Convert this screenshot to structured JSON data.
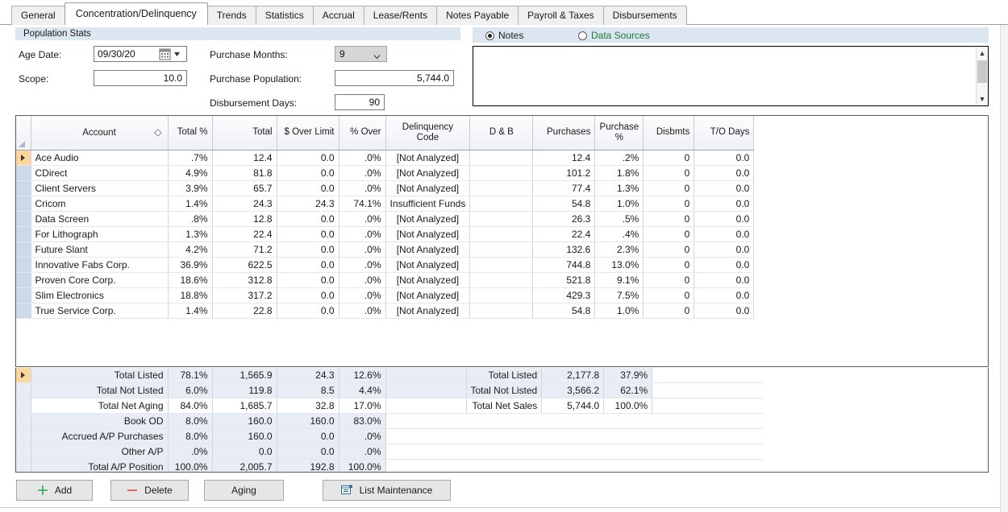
{
  "tabs": [
    {
      "label": "General",
      "active": false
    },
    {
      "label": "Concentration/Delinquency",
      "active": true
    },
    {
      "label": "Trends",
      "active": false
    },
    {
      "label": "Statistics",
      "active": false
    },
    {
      "label": "Accrual",
      "active": false
    },
    {
      "label": "Lease/Rents",
      "active": false
    },
    {
      "label": "Notes Payable",
      "active": false
    },
    {
      "label": "Payroll & Taxes",
      "active": false
    },
    {
      "label": "Disbursements",
      "active": false
    }
  ],
  "population_stats": {
    "group_title": "Population Stats",
    "age_date_label": "Age Date:",
    "age_date_value": "09/30/20",
    "scope_label": "Scope:",
    "scope_value": "10.0",
    "purchase_months_label": "Purchase Months:",
    "purchase_months_value": "9",
    "purchase_population_label": "Purchase Population:",
    "purchase_population_value": "5,744.0",
    "disbursement_days_label": "Disbursement Days:",
    "disbursement_days_value": "90"
  },
  "notes_panel": {
    "notes_label": "Notes",
    "data_sources_label": "Data Sources",
    "notes_text": "",
    "selected": "Notes"
  },
  "grid": {
    "columns": [
      "Account",
      "Total %",
      "Total",
      "$ Over Limit",
      "% Over",
      "Delinquency Code",
      "D & B",
      "Purchases",
      "Purchase\n%",
      "Disbmts",
      "T/O Days"
    ],
    "rows": [
      {
        "account": "Ace Audio",
        "total_pct": ".7%",
        "total": "12.4",
        "over_limit": "0.0",
        "pct_over": ".0%",
        "delinquency": "[Not Analyzed]",
        "db": "",
        "purchases": "12.4",
        "purchase_pct": ".2%",
        "disbmts": "0",
        "to_days": "0.0",
        "current": true
      },
      {
        "account": "CDirect",
        "total_pct": "4.9%",
        "total": "81.8",
        "over_limit": "0.0",
        "pct_over": ".0%",
        "delinquency": "[Not Analyzed]",
        "db": "",
        "purchases": "101.2",
        "purchase_pct": "1.8%",
        "disbmts": "0",
        "to_days": "0.0",
        "current": false
      },
      {
        "account": "Client Servers",
        "total_pct": "3.9%",
        "total": "65.7",
        "over_limit": "0.0",
        "pct_over": ".0%",
        "delinquency": "[Not Analyzed]",
        "db": "",
        "purchases": "77.4",
        "purchase_pct": "1.3%",
        "disbmts": "0",
        "to_days": "0.0",
        "current": false
      },
      {
        "account": "Cricom",
        "total_pct": "1.4%",
        "total": "24.3",
        "over_limit": "24.3",
        "pct_over": "74.1%",
        "delinquency": "Insufficient Funds",
        "db": "",
        "purchases": "54.8",
        "purchase_pct": "1.0%",
        "disbmts": "0",
        "to_days": "0.0",
        "current": false
      },
      {
        "account": "Data Screen",
        "total_pct": ".8%",
        "total": "12.8",
        "over_limit": "0.0",
        "pct_over": ".0%",
        "delinquency": "[Not Analyzed]",
        "db": "",
        "purchases": "26.3",
        "purchase_pct": ".5%",
        "disbmts": "0",
        "to_days": "0.0",
        "current": false
      },
      {
        "account": "For Lithograph",
        "total_pct": "1.3%",
        "total": "22.4",
        "over_limit": "0.0",
        "pct_over": ".0%",
        "delinquency": "[Not Analyzed]",
        "db": "",
        "purchases": "22.4",
        "purchase_pct": ".4%",
        "disbmts": "0",
        "to_days": "0.0",
        "current": false
      },
      {
        "account": "Future Slant",
        "total_pct": "4.2%",
        "total": "71.2",
        "over_limit": "0.0",
        "pct_over": ".0%",
        "delinquency": "[Not Analyzed]",
        "db": "",
        "purchases": "132.6",
        "purchase_pct": "2.3%",
        "disbmts": "0",
        "to_days": "0.0",
        "current": false
      },
      {
        "account": "Innovative Fabs Corp.",
        "total_pct": "36.9%",
        "total": "622.5",
        "over_limit": "0.0",
        "pct_over": ".0%",
        "delinquency": "[Not Analyzed]",
        "db": "",
        "purchases": "744.8",
        "purchase_pct": "13.0%",
        "disbmts": "0",
        "to_days": "0.0",
        "current": false
      },
      {
        "account": "Proven Core Corp.",
        "total_pct": "18.6%",
        "total": "312.8",
        "over_limit": "0.0",
        "pct_over": ".0%",
        "delinquency": "[Not Analyzed]",
        "db": "",
        "purchases": "521.8",
        "purchase_pct": "9.1%",
        "disbmts": "0",
        "to_days": "0.0",
        "current": false
      },
      {
        "account": "Slim Electronics",
        "total_pct": "18.8%",
        "total": "317.2",
        "over_limit": "0.0",
        "pct_over": ".0%",
        "delinquency": "[Not Analyzed]",
        "db": "",
        "purchases": "429.3",
        "purchase_pct": "7.5%",
        "disbmts": "0",
        "to_days": "0.0",
        "current": false
      },
      {
        "account": "True Service Corp.",
        "total_pct": "1.4%",
        "total": "22.8",
        "over_limit": "0.0",
        "pct_over": ".0%",
        "delinquency": "[Not Analyzed]",
        "db": "",
        "purchases": "54.8",
        "purchase_pct": "1.0%",
        "disbmts": "0",
        "to_days": "0.0",
        "current": false
      }
    ]
  },
  "summary": {
    "rows": [
      {
        "label": "Total Listed",
        "total_pct": "78.1%",
        "total": "1,565.9",
        "over_limit": "24.3",
        "pct_over": "12.6%",
        "right_label": "Total Listed",
        "purchases": "2,177.8",
        "purchase_pct": "37.9%",
        "current": true,
        "white": false
      },
      {
        "label": "Total Not Listed",
        "total_pct": "6.0%",
        "total": "119.8",
        "over_limit": "8.5",
        "pct_over": "4.4%",
        "right_label": "Total Not Listed",
        "purchases": "3,566.2",
        "purchase_pct": "62.1%",
        "current": false,
        "white": false
      },
      {
        "label": "Total Net Aging",
        "total_pct": "84.0%",
        "total": "1,685.7",
        "over_limit": "32.8",
        "pct_over": "17.0%",
        "right_label": "Total Net Sales",
        "purchases": "5,744.0",
        "purchase_pct": "100.0%",
        "current": false,
        "white": true
      },
      {
        "label": "Book OD",
        "total_pct": "8.0%",
        "total": "160.0",
        "over_limit": "160.0",
        "pct_over": "83.0%",
        "right_label": "",
        "purchases": "",
        "purchase_pct": "",
        "current": false,
        "white": false
      },
      {
        "label": "Accrued A/P Purchases",
        "total_pct": "8.0%",
        "total": "160.0",
        "over_limit": "0.0",
        "pct_over": ".0%",
        "right_label": "",
        "purchases": "",
        "purchase_pct": "",
        "current": false,
        "white": false
      },
      {
        "label": "Other A/P",
        "total_pct": ".0%",
        "total": "0.0",
        "over_limit": "0.0",
        "pct_over": ".0%",
        "right_label": "",
        "purchases": "",
        "purchase_pct": "",
        "current": false,
        "white": false
      },
      {
        "label": "Total A/P Position",
        "total_pct": "100.0%",
        "total": "2,005.7",
        "over_limit": "192.8",
        "pct_over": "100.0%",
        "right_label": "",
        "purchases": "",
        "purchase_pct": "",
        "current": false,
        "white": false
      }
    ]
  },
  "buttons": {
    "add": "Add",
    "delete": "Delete",
    "aging": "Aging",
    "list_maintenance": "List Maintenance"
  },
  "colors": {
    "group_header_bg": "#dce6f1",
    "summary_text": "#1b1bc8",
    "current_row": "#fdd79b",
    "add_plus": "#2aa84a",
    "delete_minus": "#d94c4c",
    "list_icon": "#2e6da4",
    "data_sources_text": "#1f7a3d"
  }
}
